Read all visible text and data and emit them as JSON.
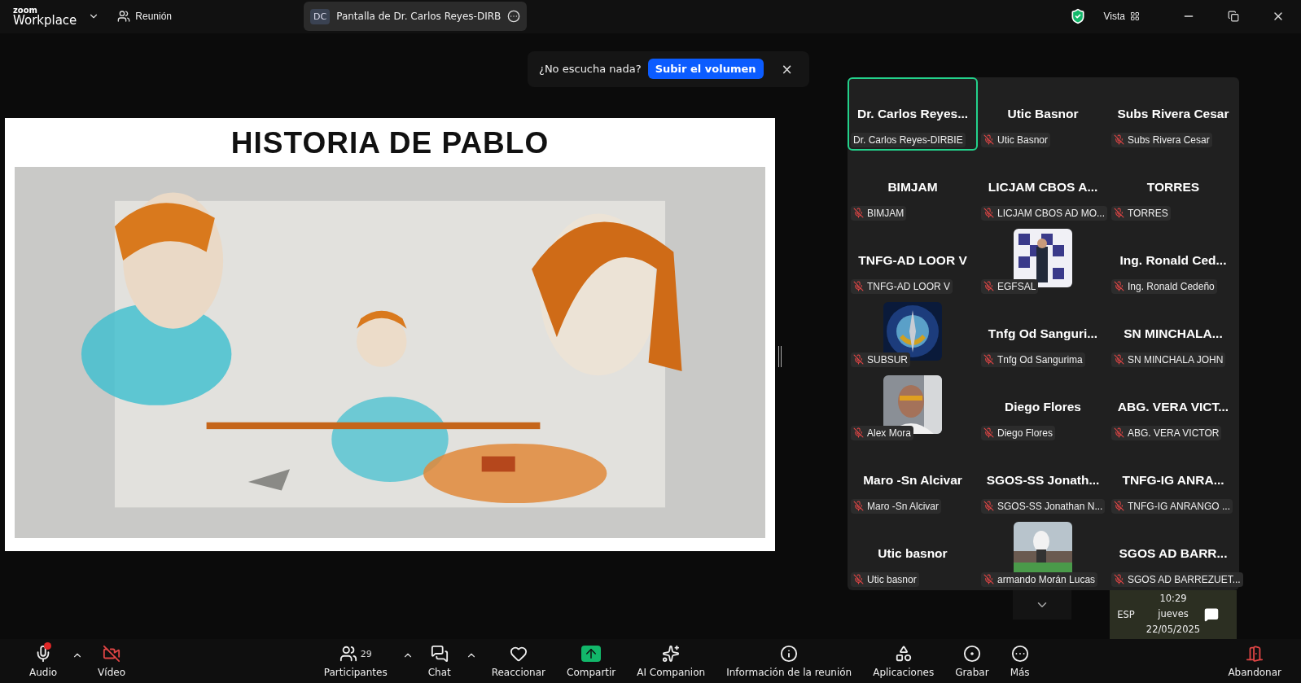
{
  "titlebar": {
    "logo_top": "zoom",
    "logo_bottom": "Workplace",
    "meeting_label": "Reunión",
    "share_badge": "DC",
    "share_title": "Pantalla de Dr. Carlos Reyes-DIRB",
    "view_label": "Vista"
  },
  "toast": {
    "message": "¿No escucha nada?",
    "action": "Subir el volumen",
    "close": "×"
  },
  "slide": {
    "title": "HISTORIA DE PABLO"
  },
  "participants": [
    {
      "kind": "name",
      "title": "Dr. Carlos Reyes...",
      "label": "Dr. Carlos Reyes-DIRBIE",
      "muted": false,
      "active": true
    },
    {
      "kind": "name",
      "title": "Utic Basnor",
      "label": "Utic Basnor",
      "muted": true,
      "active": false
    },
    {
      "kind": "name",
      "title": "Subs Rivera Cesar",
      "label": "Subs Rivera Cesar",
      "muted": true,
      "active": false
    },
    {
      "kind": "name",
      "title": "BIMJAM",
      "label": "BIMJAM",
      "muted": true,
      "active": false
    },
    {
      "kind": "name",
      "title": "LICJAM CBOS A...",
      "label": "LICJAM CBOS AD MO...",
      "muted": true,
      "active": false
    },
    {
      "kind": "name",
      "title": "TORRES",
      "label": "TORRES",
      "muted": true,
      "active": false
    },
    {
      "kind": "name",
      "title": "TNFG-AD LOOR V",
      "label": "TNFG-AD LOOR V",
      "muted": true,
      "active": false
    },
    {
      "kind": "picture",
      "label": "EGFSAL",
      "muted": true,
      "active": false
    },
    {
      "kind": "name",
      "title": "Ing. Ronald Ced...",
      "label": "Ing. Ronald Cedeño",
      "muted": true,
      "active": false
    },
    {
      "kind": "picture",
      "label": "SUBSUR",
      "muted": true,
      "active": false
    },
    {
      "kind": "name",
      "title": "Tnfg Od Sanguri...",
      "label": "Tnfg Od Sangurima",
      "muted": true,
      "active": false
    },
    {
      "kind": "name",
      "title": "SN  MINCHALA...",
      "label": "SN MINCHALA JOHN",
      "muted": true,
      "active": false
    },
    {
      "kind": "picture",
      "label": "Alex Mora",
      "muted": true,
      "active": false
    },
    {
      "kind": "name",
      "title": "Diego Flores",
      "label": "Diego Flores",
      "muted": true,
      "active": false
    },
    {
      "kind": "name",
      "title": "ABG. VERA VICT...",
      "label": "ABG. VERA VICTOR",
      "muted": true,
      "active": false
    },
    {
      "kind": "name",
      "title": "Maro -Sn Alcivar",
      "label": "Maro -Sn Alcivar",
      "muted": true,
      "active": false
    },
    {
      "kind": "name",
      "title": "SGOS-SS  Jonath...",
      "label": "SGOS-SS Jonathan N...",
      "muted": true,
      "active": false
    },
    {
      "kind": "name",
      "title": "TNFG-IG ANRA...",
      "label": "TNFG-IG ANRANGO ...",
      "muted": true,
      "active": false
    },
    {
      "kind": "name",
      "title": "Utic basnor",
      "label": "Utic basnor",
      "muted": true,
      "active": false
    },
    {
      "kind": "picture",
      "label": "armando Morán Lucas",
      "muted": true,
      "active": false
    },
    {
      "kind": "name",
      "title": "SGOS AD BARR...",
      "label": "SGOS AD BARREZUET...",
      "muted": true,
      "active": false
    }
  ],
  "clock": {
    "lang": "ESP",
    "time": "10:29",
    "day": "jueves",
    "date": "22/05/2025"
  },
  "toolbar": [
    {
      "kind": "audio",
      "label": "Audio",
      "caret": true
    },
    {
      "kind": "video",
      "label": "Vídeo",
      "caret": false
    },
    {
      "kind": "spacer"
    },
    {
      "kind": "participants",
      "label": "Participantes",
      "count": "29",
      "caret": true
    },
    {
      "kind": "chat",
      "label": "Chat",
      "caret": true
    },
    {
      "kind": "react",
      "label": "Reaccionar",
      "caret": false
    },
    {
      "kind": "share",
      "label": "Compartir",
      "caret": false
    },
    {
      "kind": "ai",
      "label": "AI Companion",
      "caret": false
    },
    {
      "kind": "info",
      "label": "Información de la reunión",
      "caret": false
    },
    {
      "kind": "apps",
      "label": "Aplicaciones",
      "caret": false
    },
    {
      "kind": "record",
      "label": "Grabar",
      "caret": false
    },
    {
      "kind": "more",
      "label": "Más",
      "caret": false
    },
    {
      "kind": "spacer"
    },
    {
      "kind": "leave",
      "label": "Abandonar",
      "caret": false
    }
  ]
}
